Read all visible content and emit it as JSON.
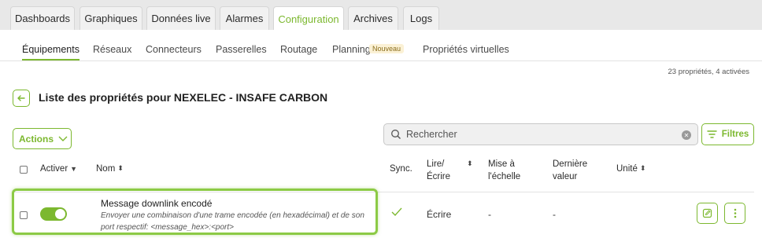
{
  "top_tabs": [
    {
      "label": "Dashboards"
    },
    {
      "label": "Graphiques"
    },
    {
      "label": "Données live"
    },
    {
      "label": "Alarmes"
    },
    {
      "label": "Configuration"
    },
    {
      "label": "Archives"
    },
    {
      "label": "Logs"
    }
  ],
  "active_top_tab": "Configuration",
  "sub_tabs": [
    {
      "label": "Équipements"
    },
    {
      "label": "Réseaux"
    },
    {
      "label": "Connecteurs"
    },
    {
      "label": "Passerelles"
    },
    {
      "label": "Routage"
    },
    {
      "label": "Planning"
    },
    {
      "label": "Propriétés virtuelles"
    }
  ],
  "planning_badge": "Nouveau",
  "active_sub_tab": "Équipements",
  "count_text": "23 propriétés, 4 activées",
  "page_title": "Liste des propriétés pour NEXELEC - INSAFE CARBON",
  "actions_label": "Actions",
  "search": {
    "placeholder": "Rechercher"
  },
  "filters_label": "Filtres",
  "columns": {
    "activer": "Activer",
    "nom": "Nom",
    "sync": "Sync.",
    "lire_line1": "Lire/",
    "lire_line2": "Écrire",
    "scale_line1": "Mise à",
    "scale_line2": "l'échelle",
    "last_line1": "Dernière",
    "last_line2": "valeur",
    "unite": "Unité"
  },
  "rows": [
    {
      "enabled": true,
      "name": "Message downlink encodé",
      "description": "Envoyer une combinaison d'une trame encodée (en hexadécimal) et de son port respectif: <message_hex>:<port>",
      "synced": true,
      "read_write": "Écrire",
      "scaling": "-",
      "last_value": "-",
      "unit": ""
    }
  ],
  "colors": {
    "accent": "#7cb82f",
    "highlight": "#8cca45"
  }
}
